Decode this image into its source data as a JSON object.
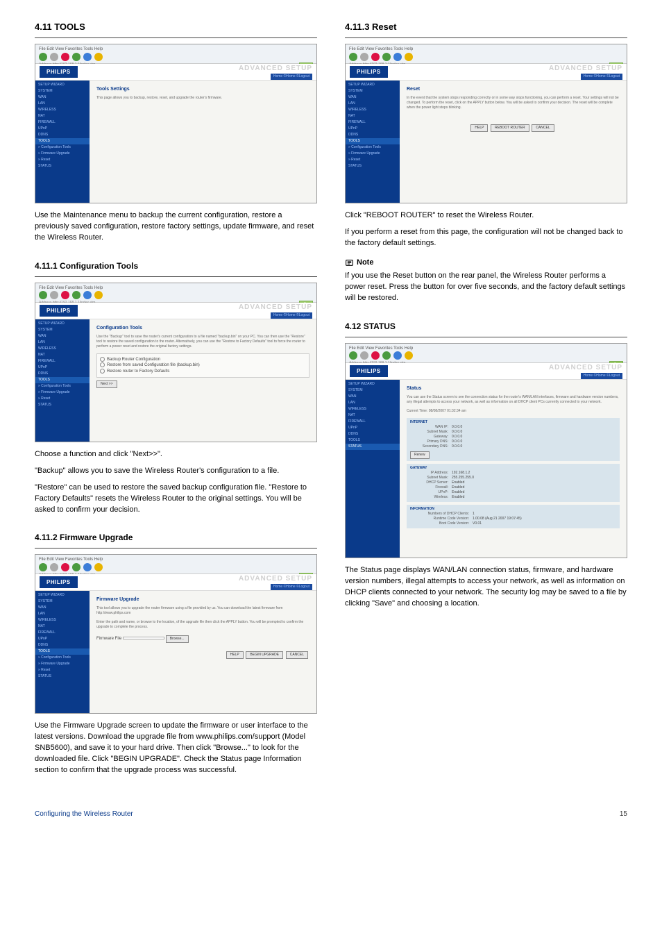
{
  "sections": {
    "s411": {
      "title": "4.11 TOOLS"
    },
    "s4111": {
      "title": "4.11.1 Configuration Tools"
    },
    "s4112": {
      "title": "4.11.2 Firmware Upgrade"
    },
    "s4113": {
      "title": "4.11.3 Reset"
    },
    "s412": {
      "title": "4.12 STATUS"
    }
  },
  "browser": {
    "menu": "File  Edit  View  Favorites  Tools  Help",
    "addr": "Address  http://192.168.1.1/index.stm",
    "go": "Go"
  },
  "header": {
    "logo": "PHILIPS",
    "adv": "ADVANCED SETUP",
    "home": "Home  ©Home  ©Logout"
  },
  "sidebar": {
    "items": [
      "SETUP WIZARD",
      "SYSTEM",
      "WAN",
      "LAN",
      "WIRELESS",
      "NAT",
      "FIREWALL",
      "UPnP",
      "DDNS",
      "TOOLS",
      "» Configuration Tools",
      "» Firmware Upgrade",
      "» Reset",
      "STATUS"
    ]
  },
  "sidebar_status": {
    "items": [
      "SETUP WIZARD",
      "SYSTEM",
      "WAN",
      "LAN",
      "WIRELESS",
      "NAT",
      "FIREWALL",
      "UPnP",
      "DDNS",
      "TOOLS",
      "STATUS"
    ]
  },
  "panel_tools": {
    "title": "Tools Settings",
    "text": "This page allows you to backup, restore, reset, and upgrade the router's firmware."
  },
  "panel_config": {
    "title": "Configuration Tools",
    "text": "Use the \"Backup\" tool to save the router's current configuration to a file named \"backup.bin\" on your PC. You can then use the \"Restore\" tool to restore the saved configuration to the router. Alternatively, you can use the \"Restore to Factory Defaults\" tool to force the router to perform a power reset and restore the original factory settings.",
    "opt1": "Backup Router Configuration",
    "opt2": "Restore from saved Configuration file (backup.bin)",
    "opt3": "Restore router to Factory Defaults",
    "next": "Next >>"
  },
  "panel_fw": {
    "title": "Firmware Upgrade",
    "text1": "This tool allows you to upgrade the router firmware using a file provided by us. You can download the latest firmware from http://www.philips.com",
    "text2": "Enter the path and name, or browse to the location, of the upgrade file then click the APPLY button. You will be prompted to confirm the upgrade to complete the process.",
    "label": "Firmware File",
    "browse": "Browse...",
    "help": "HELP",
    "begin": "BEGIN UPGRADE",
    "cancel": "CANCEL"
  },
  "panel_reset": {
    "title": "Reset",
    "text": "In the event that the system stops responding correctly or in some way stops functioning, you can perform a reset. Your settings will not be changed. To perform the reset, click on the APPLY button below. You will be asked to confirm your decision. The reset will be complete when the power light stops blinking.",
    "help": "HELP",
    "reboot": "REBOOT ROUTER",
    "cancel": "CANCEL"
  },
  "panel_status": {
    "title": "Status",
    "text": "You can use the Status screen to see the connection status for the router's WAN/LAN interfaces, firmware and hardware version numbers, any illegal attempts to access your network, as well as information on all DHCP client PCs currently connected to your network.",
    "time_lbl": "Current Time:",
    "time_val": "08/08/2007 01:32:34 am",
    "internet_h": "INTERNET",
    "gateway_h": "GATEWAY",
    "info_h": "INFORMATION",
    "renew": "Renew",
    "internet": {
      "wan_ip_lbl": "WAN IP:",
      "wan_ip": "0.0.0.0",
      "subnet_lbl": "Subnet Mask:",
      "subnet": "0.0.0.0",
      "gw_lbl": "Gateway:",
      "gw": "0.0.0.0",
      "pdns_lbl": "Primary DNS:",
      "pdns": "0.0.0.0",
      "sdns_lbl": "Secondary DNS:",
      "sdns": "0.0.0.0"
    },
    "gateway": {
      "ip_lbl": "IP Address:",
      "ip": "192.168.1.2",
      "subnet_lbl": "Subnet Mask:",
      "subnet": "255.255.255.0",
      "dhcp_lbl": "DHCP Server:",
      "dhcp": "Enabled",
      "fw_lbl": "Firewall:",
      "fw": "Enabled",
      "upnp_lbl": "UPnP:",
      "upnp": "Enabled",
      "wl_lbl": "Wireless:",
      "wl": "Enabled"
    },
    "info": {
      "clients_lbl": "Numbers of DHCP Clients:",
      "clients": "1",
      "rt_lbl": "Runtime Code Version:",
      "rt": "1.00.08 (Aug 21 2007 19:07:45)",
      "bc_lbl": "Boot Code Version:",
      "bc": "V0.01"
    }
  },
  "text": {
    "s411_after": "Use the Maintenance menu to backup the current configuration, restore a previously saved configuration, restore factory settings, update firmware, and reset the Wireless Router.",
    "s4111_1": "Choose a function and click \"Next>>\".",
    "s4111_2": "\"Backup\" allows you to save the Wireless Router's configuration to a file.",
    "s4111_3": "\"Restore\" can be used to restore the saved backup configuration file. \"Restore to Factory Defaults\" resets the Wireless Router to the original settings. You will be asked to confirm your decision.",
    "s4112_after": "Use the Firmware Upgrade screen to update the firmware or user interface to the latest versions. Download the upgrade file from www.philips.com/support (Model SNB5600), and save it to your hard drive. Then click \"Browse...\" to look for the downloaded file. Click \"BEGIN UPGRADE\". Check the Status page Information section to confirm that the upgrade process was successful.",
    "s4113_1": "Click \"REBOOT ROUTER\" to reset the Wireless Router.",
    "s4113_2": "If you perform a reset from this page, the configuration will not be changed back to the factory default settings.",
    "note_label": "Note",
    "note_text": "If you use the Reset button on the rear panel, the Wireless Router performs a power reset. Press the button for over five seconds, and the factory default settings will be restored.",
    "s412_after": "The Status page displays WAN/LAN connection status, firmware, and hardware version numbers, illegal attempts to access your network, as well as information on DHCP clients connected to your network. The security log may be saved to a file by clicking \"Save\" and choosing a location."
  },
  "footer": {
    "left": "Configuring the Wireless Router",
    "right": "15"
  }
}
